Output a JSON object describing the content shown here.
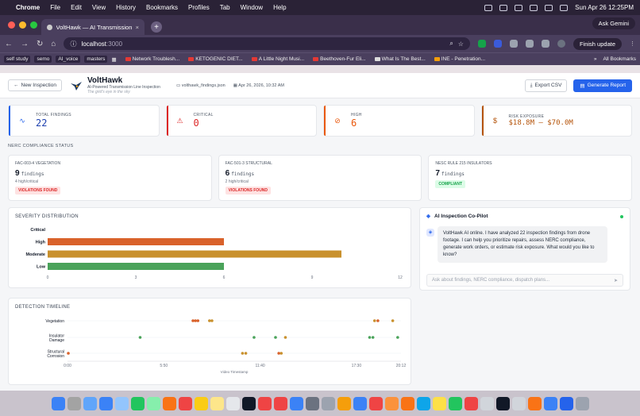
{
  "menubar": {
    "app": "Chrome",
    "items": [
      "File",
      "Edit",
      "View",
      "History",
      "Bookmarks",
      "Profiles",
      "Tab",
      "Window",
      "Help"
    ],
    "clock": "Sun Apr 26  12:25PM"
  },
  "browser": {
    "tab_title": "VoltHawk — AI Transmission L",
    "ask_gemini": "Ask Gemini",
    "url_host": "localhost",
    "url_port": ":3000",
    "finish_update": "Finish update",
    "bookmark_chips": [
      "self study",
      "semo",
      "AI_voice",
      "masters"
    ],
    "bookmarks": [
      "Network Troublesh...",
      "KETOGENIC DIET...",
      "A Little Night Musi...",
      "Beethoven-Fur Eli...",
      "What Is The Best...",
      "INE - Penetration..."
    ],
    "all_bookmarks": "All Bookmarks"
  },
  "header": {
    "new_inspection": "New Inspection",
    "title": "VoltHawk",
    "subtitle": "AI-Powered Transmission Line Inspection",
    "tagline": "The grid's eye in the sky",
    "file": "volthawk_findings.json",
    "date": "Apr 26, 2026, 10:32 AM",
    "export_csv": "Export CSV",
    "generate_report": "Generate Report"
  },
  "kpis": [
    {
      "label": "TOTAL FINDINGS",
      "value": "22",
      "color": "#2563eb",
      "icon": "pulse-icon"
    },
    {
      "label": "CRITICAL",
      "value": "0",
      "color": "#dc2626",
      "icon": "alert-triangle-icon"
    },
    {
      "label": "HIGH",
      "value": "6",
      "color": "#ea580c",
      "icon": "alert-circle-icon"
    },
    {
      "label": "RISK EXPOSURE",
      "value": "$18.8M – $70.0M",
      "color": "#b45309",
      "icon": "dollar-icon"
    }
  ],
  "nerc": {
    "section_title": "NERC COMPLIANCE STATUS",
    "cards": [
      {
        "title": "FAC-003-4 VEGETATION",
        "count": "9",
        "unit": "findings",
        "sub": "4 high/critical",
        "status": "VIOLATIONS FOUND",
        "status_color": "#dc2626"
      },
      {
        "title": "FAC-501-3 STRUCTURAL",
        "count": "6",
        "unit": "findings",
        "sub": "2 high/critical",
        "status": "VIOLATIONS FOUND",
        "status_color": "#dc2626"
      },
      {
        "title": "NESC RULE 215 INSULATORS",
        "count": "7",
        "unit": "findings",
        "sub": "",
        "status": "COMPLIANT",
        "status_color": "#16a34a"
      }
    ]
  },
  "chart_data": [
    {
      "type": "bar",
      "title": "SEVERITY DISTRIBUTION",
      "orientation": "horizontal",
      "categories": [
        "Critical",
        "High",
        "Moderate",
        "Low"
      ],
      "values": [
        0,
        6,
        10,
        6
      ],
      "colors": [
        "#dc2626",
        "#d9622b",
        "#c9912e",
        "#4aa35a"
      ],
      "xticks": [
        "0",
        "3",
        "6",
        "9",
        "12"
      ],
      "xlim": [
        0,
        12
      ]
    },
    {
      "type": "scatter",
      "title": "DETECTION TIMELINE",
      "xlabel": "Video Timestamp",
      "xticks": [
        "0:00",
        "5:50",
        "11:40",
        "17:30",
        "20:12"
      ],
      "categories": [
        "Vegetation",
        "Insulator Damage",
        "Structural Corrosion"
      ],
      "category_lines": [
        [
          "Vegetation"
        ],
        [
          "Insulator",
          "Damage"
        ],
        [
          "Structural",
          "Corrosion"
        ]
      ],
      "points": [
        {
          "cat": 0,
          "x": 7.6,
          "color": "#d9622b"
        },
        {
          "cat": 0,
          "x": 7.75,
          "color": "#d9622b"
        },
        {
          "cat": 0,
          "x": 7.9,
          "color": "#d9622b"
        },
        {
          "cat": 0,
          "x": 8.6,
          "color": "#c9912e"
        },
        {
          "cat": 0,
          "x": 8.75,
          "color": "#c9912e"
        },
        {
          "cat": 0,
          "x": 18.6,
          "color": "#c9912e"
        },
        {
          "cat": 0,
          "x": 18.8,
          "color": "#d9622b"
        },
        {
          "cat": 0,
          "x": 19.7,
          "color": "#c9912e"
        },
        {
          "cat": 1,
          "x": 4.4,
          "color": "#4aa35a"
        },
        {
          "cat": 1,
          "x": 11.3,
          "color": "#4aa35a"
        },
        {
          "cat": 1,
          "x": 12.6,
          "color": "#4aa35a"
        },
        {
          "cat": 1,
          "x": 13.2,
          "color": "#c9912e"
        },
        {
          "cat": 1,
          "x": 18.3,
          "color": "#4aa35a"
        },
        {
          "cat": 1,
          "x": 18.5,
          "color": "#4aa35a"
        },
        {
          "cat": 1,
          "x": 20.0,
          "color": "#4aa35a"
        },
        {
          "cat": 2,
          "x": 0.05,
          "color": "#d9622b"
        },
        {
          "cat": 2,
          "x": 10.6,
          "color": "#c9912e"
        },
        {
          "cat": 2,
          "x": 10.8,
          "color": "#c9912e"
        },
        {
          "cat": 2,
          "x": 12.8,
          "color": "#d9622b"
        },
        {
          "cat": 2,
          "x": 12.95,
          "color": "#c9912e"
        }
      ],
      "xlim": [
        0,
        20.2
      ]
    }
  ],
  "copilot": {
    "title": "AI Inspection Co-Pilot",
    "message": "VoltHawk AI online. I have analyzed 22 inspection findings from drone footage. I can help you prioritize repairs, assess NERC compliance, generate work orders, or estimate risk exposure. What would you like to know?",
    "placeholder": "Ask about findings, NERC compliance, dispatch plans..."
  }
}
